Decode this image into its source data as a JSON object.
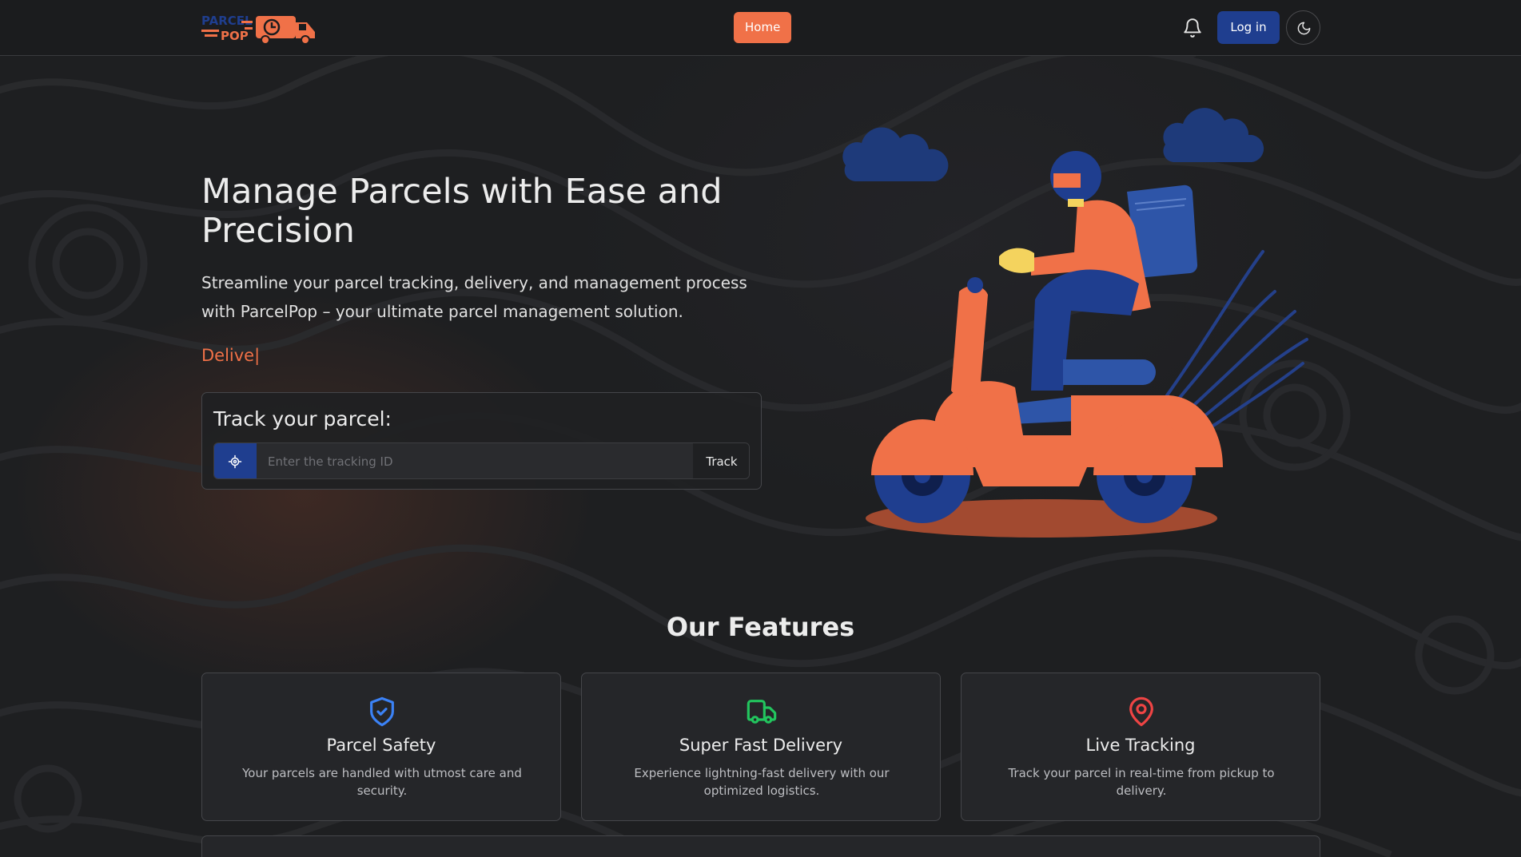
{
  "navbar": {
    "logo": {
      "line1": "PARCEL",
      "line2": "POP",
      "colors": {
        "text": "#1f3e8f",
        "truck": "#f07148"
      }
    },
    "home_label": "Home",
    "bell_icon": "bell-icon",
    "login_label": "Log in",
    "theme_icon": "moon-icon"
  },
  "hero": {
    "title": "Manage Parcels with Ease and Precision",
    "subtitle": "Streamline your parcel tracking, delivery, and management process with ParcelPop – your ultimate parcel management solution.",
    "typing_text": "Delive|",
    "track": {
      "title": "Track your parcel:",
      "icon": "crosshair-icon",
      "placeholder": "Enter the tracking ID",
      "value": "",
      "button_label": "Track"
    }
  },
  "features": {
    "title": "Our Features",
    "items": [
      {
        "icon": "shield-check-icon",
        "name": "Parcel Safety",
        "description": "Your parcels are handled with utmost care and security.",
        "color": "#3b82f6"
      },
      {
        "icon": "truck-icon",
        "name": "Super Fast Delivery",
        "description": "Experience lightning-fast delivery with our optimized logistics.",
        "color": "#22c55e"
      },
      {
        "icon": "map-pin-icon",
        "name": "Live Tracking",
        "description": "Track your parcel in real-time from pickup to delivery.",
        "color": "#ef4444"
      }
    ]
  },
  "colors": {
    "accent": "#f07148",
    "primary": "#1f3e8f",
    "background": "#1e1f21"
  }
}
